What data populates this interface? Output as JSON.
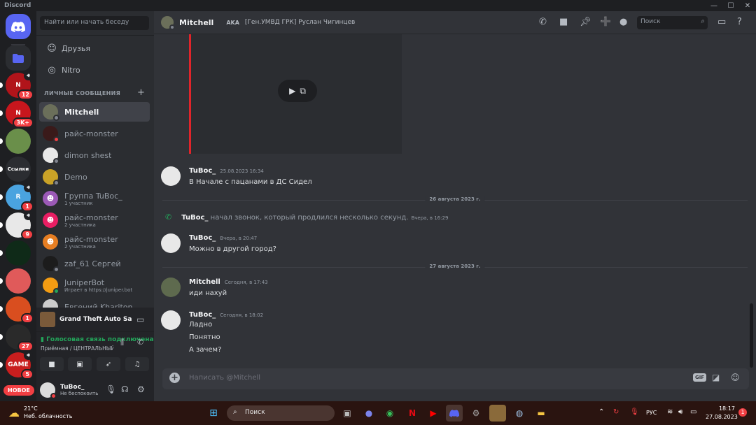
{
  "window": {
    "app_name": "Discord",
    "controls": [
      "—",
      "☐",
      "✕"
    ]
  },
  "rail": {
    "home_icon": "discord-logo-icon",
    "folder_icon": "folder-icon",
    "servers": [
      {
        "badge": "12",
        "volume": true,
        "color": "#b1141a",
        "label": "N"
      },
      {
        "badge": "3K+",
        "volume": false,
        "color": "#c8161d",
        "label": "N"
      },
      {
        "badge": "",
        "volume": false,
        "color": "#6a8f4a",
        "label": ""
      },
      {
        "badge": "",
        "volume": false,
        "color": "#2b2d31",
        "label": "Ссылки"
      },
      {
        "badge": "1",
        "volume": true,
        "color": "#4aa3df",
        "label": "R"
      },
      {
        "badge": "9",
        "volume": true,
        "color": "#e8e8e8",
        "label": ""
      },
      {
        "badge": "",
        "volume": false,
        "color": "#0f2a18",
        "label": ""
      },
      {
        "badge": "",
        "volume": false,
        "color": "#e05a5a",
        "label": ""
      },
      {
        "badge": "1",
        "volume": false,
        "color": "#d94e1f",
        "label": ""
      },
      {
        "badge": "27",
        "volume": false,
        "color": "#2a2a2a",
        "label": ""
      },
      {
        "badge": "5",
        "volume": true,
        "color": "#c81e1e",
        "label": "GAME"
      }
    ],
    "new_label": "НОВОЕ"
  },
  "sidebar": {
    "search_placeholder": "Найти или начать беседу",
    "nav": [
      {
        "label": "Друзья",
        "icon": "friends-icon"
      },
      {
        "label": "Nitro",
        "icon": "nitro-icon"
      }
    ],
    "dm_header": "ЛИЧНЫЕ СООБЩЕНИЯ",
    "dms": [
      {
        "name": "Mitchell",
        "sub": "",
        "status": "#80848e",
        "color": "#6b6f5a",
        "active": true
      },
      {
        "name": "райс-monster",
        "sub": "",
        "status": "#f23f43",
        "color": "#3a1a1a",
        "active": false
      },
      {
        "name": "dimon shest",
        "sub": "",
        "status": "#80848e",
        "color": "#e8e8e8",
        "active": false
      },
      {
        "name": "Demo",
        "sub": "",
        "status": "#80848e",
        "color": "#c9a227",
        "active": false
      },
      {
        "name": "Группа TuBoc_",
        "sub": "1 участник",
        "status": "",
        "color": "#9b59b6",
        "active": false
      },
      {
        "name": "райс-monster",
        "sub": "2 участника",
        "status": "",
        "color": "#e91e63",
        "active": false
      },
      {
        "name": "райс-monster",
        "sub": "2 участника",
        "status": "",
        "color": "#e67e22",
        "active": false
      },
      {
        "name": "zaf_61 Сергей",
        "sub": "",
        "status": "#80848e",
        "color": "#1c1c1c",
        "active": false
      },
      {
        "name": "JuniperBot",
        "sub": "Играет в https://juniper.bot",
        "status": "#23a55a",
        "color": "#f39c12",
        "active": false
      },
      {
        "name": "Евгений Khariton",
        "sub": "",
        "status": "",
        "color": "#cccccc",
        "active": false
      }
    ],
    "activity": {
      "game": "Grand Theft Auto San Andreas"
    },
    "voice": {
      "status": "Голосовая связь подключена",
      "channel": "Приёмная / ЦЕНТРАЛЬНЫЙ СЕРВЕР"
    },
    "user": {
      "name": "TuBoc_",
      "status": "Не беспокоить"
    }
  },
  "header": {
    "name": "Mitchell",
    "aka_label": "AKA",
    "aka_name": "[Ген.УМВД ГРК] Руслан Чигинцев",
    "search_placeholder": "Поиск"
  },
  "messages": [
    {
      "author": "TuBoc_",
      "time": "25.08.2023 16:34",
      "lines": [
        "В Начале с пацанами в ДС Сидел"
      ]
    },
    {
      "divider": "26 августа 2023 г."
    },
    {
      "call": true,
      "author": "TuBoc_",
      "text": "начал звонок, который продлился несколько секунд.",
      "time": "Вчера, в 16:29"
    },
    {
      "author": "TuBoc_",
      "time": "Вчера, в 20:47",
      "lines": [
        "Можно в другой город?"
      ]
    },
    {
      "divider": "27 августа 2023 г."
    },
    {
      "author": "Mitchell",
      "time": "Сегодня, в 17:43",
      "lines": [
        "иди нахуй"
      ]
    },
    {
      "author": "TuBoc_",
      "time": "Сегодня, в 18:02",
      "lines": [
        "Ладно",
        "Понятно",
        "А зачем?"
      ]
    }
  ],
  "composer": {
    "placeholder": "Написать @Mitchell",
    "gif_label": "GIF"
  },
  "taskbar": {
    "weather_temp": "21°C",
    "weather_desc": "Неб. облачность",
    "search_label": "Поиск",
    "lang": "РУС",
    "time": "18:17",
    "date": "27.08.2023",
    "notifications": "1"
  }
}
